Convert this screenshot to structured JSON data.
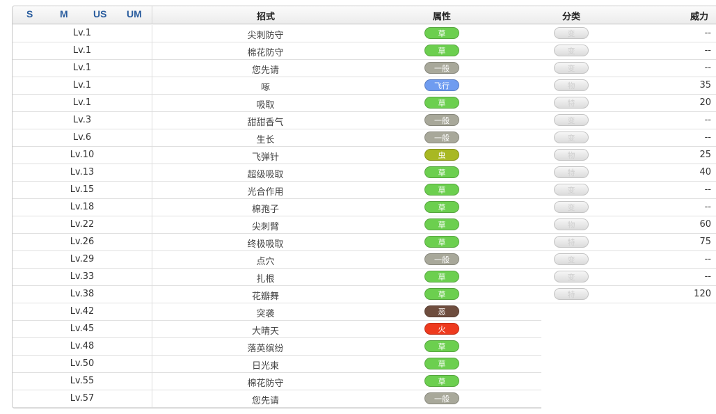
{
  "header": {
    "versions": [
      "S",
      "M",
      "US",
      "UM"
    ],
    "col_move": "招式",
    "col_type": "属性",
    "col_category": "分类",
    "col_power": "威力"
  },
  "colors": {
    "草": "#6ccf4f",
    "一般": "#a8a89a",
    "飞行": "#6f9cf0",
    "虫": "#a8b823",
    "恶": "#6e4d3e",
    "火": "#ee3a1e"
  },
  "rows": [
    {
      "level": "Lv.1",
      "move": "尖刺防守",
      "type": "草",
      "category": "变",
      "power": "--"
    },
    {
      "level": "Lv.1",
      "move": "棉花防守",
      "type": "草",
      "category": "变",
      "power": "--"
    },
    {
      "level": "Lv.1",
      "move": "您先请",
      "type": "一般",
      "category": "变",
      "power": "--"
    },
    {
      "level": "Lv.1",
      "move": "啄",
      "type": "飞行",
      "category": "物",
      "power": "35"
    },
    {
      "level": "Lv.1",
      "move": "吸取",
      "type": "草",
      "category": "特",
      "power": "20"
    },
    {
      "level": "Lv.3",
      "move": "甜甜香气",
      "type": "一般",
      "category": "变",
      "power": "--"
    },
    {
      "level": "Lv.6",
      "move": "生长",
      "type": "一般",
      "category": "变",
      "power": "--"
    },
    {
      "level": "Lv.10",
      "move": "飞弹针",
      "type": "虫",
      "category": "物",
      "power": "25"
    },
    {
      "level": "Lv.13",
      "move": "超级吸取",
      "type": "草",
      "category": "特",
      "power": "40"
    },
    {
      "level": "Lv.15",
      "move": "光合作用",
      "type": "草",
      "category": "变",
      "power": "--"
    },
    {
      "level": "Lv.18",
      "move": "棉孢子",
      "type": "草",
      "category": "变",
      "power": "--"
    },
    {
      "level": "Lv.22",
      "move": "尖刺臂",
      "type": "草",
      "category": "物",
      "power": "60"
    },
    {
      "level": "Lv.26",
      "move": "终极吸取",
      "type": "草",
      "category": "特",
      "power": "75"
    },
    {
      "level": "Lv.29",
      "move": "点穴",
      "type": "一般",
      "category": "变",
      "power": "--"
    },
    {
      "level": "Lv.33",
      "move": "扎根",
      "type": "草",
      "category": "变",
      "power": "--"
    },
    {
      "level": "Lv.38",
      "move": "花瓣舞",
      "type": "草",
      "category": "特",
      "power": "120"
    },
    {
      "level": "Lv.42",
      "move": "突袭",
      "type": "恶",
      "category": "",
      "power": ""
    },
    {
      "level": "Lv.45",
      "move": "大晴天",
      "type": "火",
      "category": "",
      "power": ""
    },
    {
      "level": "Lv.48",
      "move": "落英缤纷",
      "type": "草",
      "category": "",
      "power": ""
    },
    {
      "level": "Lv.50",
      "move": "日光束",
      "type": "草",
      "category": "",
      "power": ""
    },
    {
      "level": "Lv.55",
      "move": "棉花防守",
      "type": "草",
      "category": "",
      "power": ""
    },
    {
      "level": "Lv.57",
      "move": "您先请",
      "type": "一般",
      "category": "",
      "power": ""
    }
  ]
}
